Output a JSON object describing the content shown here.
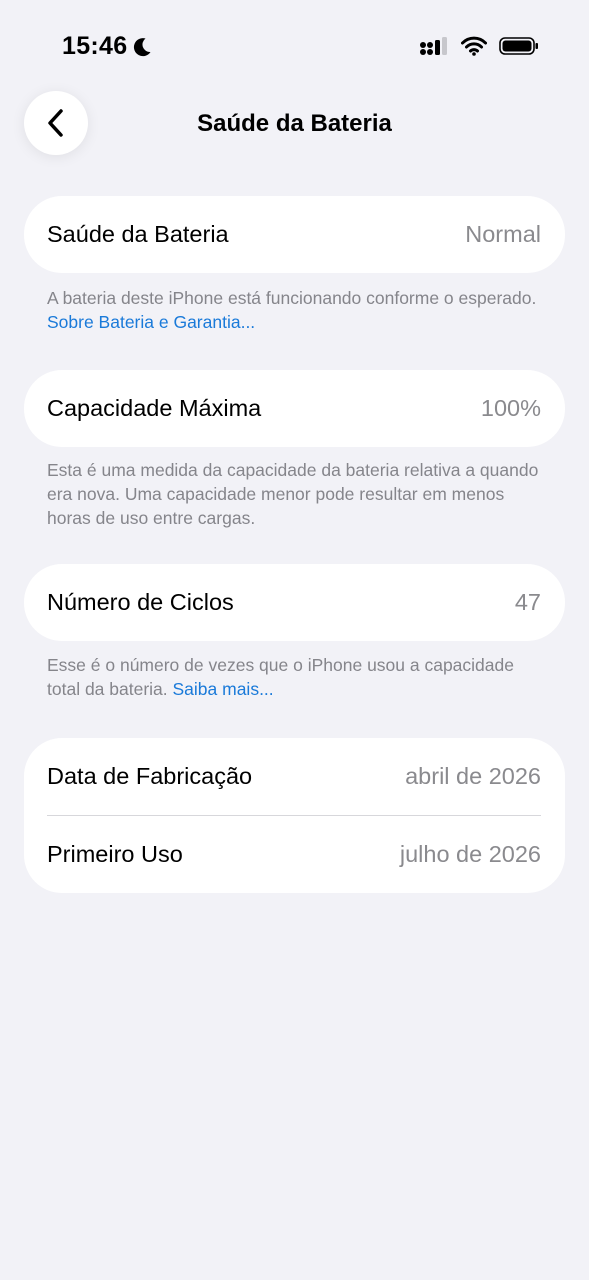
{
  "status_bar": {
    "time": "15:46"
  },
  "nav": {
    "title": "Saúde da Bateria"
  },
  "battery_health": {
    "label": "Saúde da Bateria",
    "value": "Normal",
    "footer_text": "A bateria deste iPhone está funcionando conforme o esperado. ",
    "footer_link": "Sobre Bateria e Garantia..."
  },
  "max_capacity": {
    "label": "Capacidade Máxima",
    "value": "100%",
    "footer_text": "Esta é uma medida da capacidade da bateria relativa a quando era nova. Uma capacidade menor pode resultar em menos horas de uso entre cargas."
  },
  "cycle_count": {
    "label": "Número de Ciclos",
    "value": "47",
    "footer_text": "Esse é o número de vezes que o iPhone usou a capacidade total da bateria. ",
    "footer_link": "Saiba mais..."
  },
  "dates": {
    "manufacture_label": "Data de Fabricação",
    "manufacture_value": "abril de 2026",
    "first_use_label": "Primeiro Uso",
    "first_use_value": "julho de 2026"
  },
  "icons": {
    "back": "chevron-left-icon",
    "moon": "moon-icon",
    "signal": "cellular-signal-icon",
    "wifi": "wifi-icon",
    "battery": "battery-icon"
  },
  "colors": {
    "background": "#f2f2f7",
    "link": "#1a7ad9",
    "secondary_text": "#8a8a8e"
  }
}
